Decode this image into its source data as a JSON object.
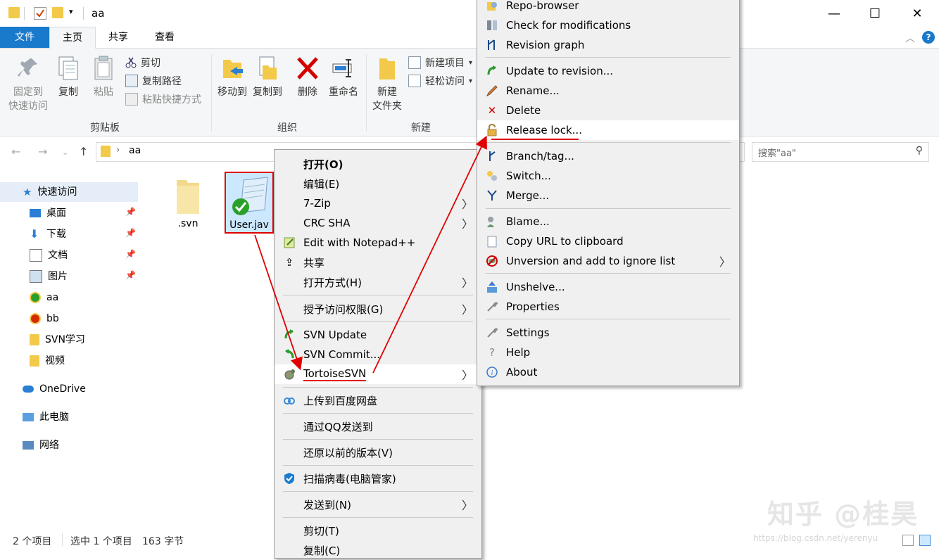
{
  "window": {
    "title": "aa",
    "controls": {
      "minimize": "—",
      "maximize": "☐",
      "close": "✕"
    }
  },
  "ribbon": {
    "tabs": [
      {
        "label": "文件"
      },
      {
        "label": "主页"
      },
      {
        "label": "共享"
      },
      {
        "label": "查看"
      }
    ],
    "clipboard": {
      "pin_line1": "固定到",
      "pin_line2": "快速访问",
      "copy": "复制",
      "paste": "粘贴",
      "cut": "剪切",
      "copy_path": "复制路径",
      "paste_shortcut": "粘贴快捷方式",
      "group_label": "剪贴板"
    },
    "organize": {
      "move_to": "移动到",
      "copy_to": "复制到",
      "delete": "删除",
      "rename": "重命名",
      "group_label": "组织"
    },
    "new": {
      "new_folder_line1": "新建",
      "new_folder_line2": "文件夹",
      "new_item": "新建项目",
      "easy_access": "轻松访问",
      "group_label": "新建"
    }
  },
  "address": {
    "path": "aa",
    "search_placeholder": "搜索\"aa\""
  },
  "nav_pane": {
    "quick_access": "快速访问",
    "items": [
      {
        "label": "桌面",
        "pinned": true
      },
      {
        "label": "下载",
        "pinned": true
      },
      {
        "label": "文档",
        "pinned": true
      },
      {
        "label": "图片",
        "pinned": true
      },
      {
        "label": "aa",
        "pinned": false
      },
      {
        "label": "bb",
        "pinned": false
      },
      {
        "label": "SVN学习",
        "pinned": false
      },
      {
        "label": "视频",
        "pinned": false
      }
    ],
    "onedrive": "OneDrive",
    "this_pc": "此电脑",
    "network": "网络"
  },
  "files": [
    {
      "name": ".svn",
      "icon": "folder-icon"
    },
    {
      "name": "User.jav",
      "icon": "svn-notepad-icon"
    }
  ],
  "status": {
    "count": "2 个项目",
    "selected": "选中 1 个项目",
    "size": "163 字节"
  },
  "context_menu": {
    "items": [
      {
        "label": "打开(O)",
        "bold": true
      },
      {
        "label": "编辑(E)"
      },
      {
        "label": "7-Zip",
        "submenu": true
      },
      {
        "label": "CRC SHA",
        "submenu": true
      },
      {
        "label": "Edit with Notepad++"
      },
      {
        "label": "共享"
      },
      {
        "label": "打开方式(H)",
        "submenu": true
      },
      {
        "label": "授予访问权限(G)",
        "submenu": true
      },
      {
        "label": "SVN Update"
      },
      {
        "label": "SVN Commit..."
      },
      {
        "label": "TortoiseSVN",
        "submenu": true
      },
      {
        "label": "上传到百度网盘"
      },
      {
        "label": "通过QQ发送到"
      },
      {
        "label": "还原以前的版本(V)"
      },
      {
        "label": "扫描病毒(电脑管家)"
      },
      {
        "label": "发送到(N)",
        "submenu": true
      },
      {
        "label": "剪切(T)"
      },
      {
        "label": "复制(C)"
      }
    ]
  },
  "svn_menu": {
    "items": [
      {
        "label": "Repo-browser"
      },
      {
        "label": "Check for modifications"
      },
      {
        "label": "Revision graph"
      },
      {
        "label": "Update to revision..."
      },
      {
        "label": "Rename..."
      },
      {
        "label": "Delete"
      },
      {
        "label": "Release lock..."
      },
      {
        "label": "Branch/tag..."
      },
      {
        "label": "Switch..."
      },
      {
        "label": "Merge..."
      },
      {
        "label": "Blame..."
      },
      {
        "label": "Copy URL to clipboard"
      },
      {
        "label": "Unversion and add to ignore list",
        "submenu": true
      },
      {
        "label": "Unshelve..."
      },
      {
        "label": "Properties"
      },
      {
        "label": "Settings"
      },
      {
        "label": "Help"
      },
      {
        "label": "About"
      }
    ]
  },
  "watermark": {
    "text": "知乎 @桂昊",
    "url": "https://blog.csdn.net/yerenyu"
  },
  "colors": {
    "file_tab": "#1979ca",
    "annotation_red": "#e00000",
    "selection": "#cce8ff"
  }
}
